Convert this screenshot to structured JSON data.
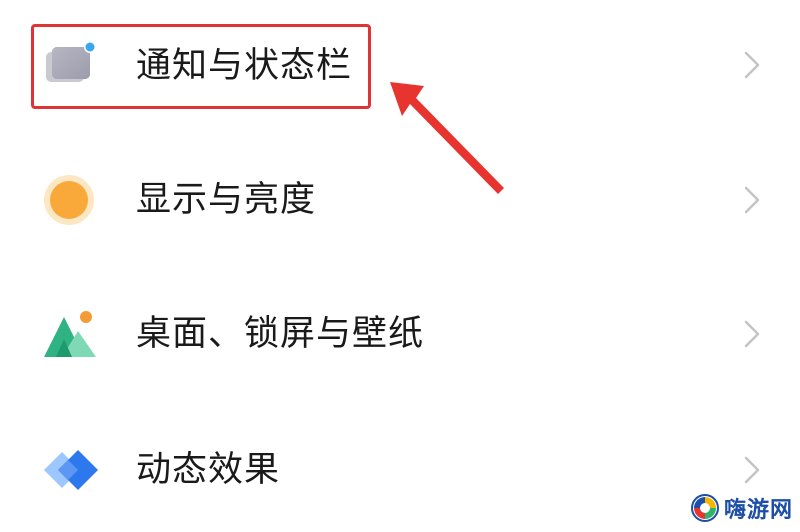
{
  "settings_list": {
    "items": [
      {
        "label": "通知与状态栏",
        "icon": "notification-cards-icon",
        "highlighted": true
      },
      {
        "label": "显示与亮度",
        "icon": "sun-icon",
        "highlighted": false
      },
      {
        "label": "桌面、锁屏与壁纸",
        "icon": "mountain-wallpaper-icon",
        "highlighted": false
      },
      {
        "label": "动态效果",
        "icon": "diamond-layers-icon",
        "highlighted": false
      }
    ]
  },
  "annotation": {
    "box_color": "#e03434",
    "arrow_color": "#e8342e"
  },
  "watermark": {
    "text": "嗨游网",
    "text_color": "#1d4ea8"
  }
}
